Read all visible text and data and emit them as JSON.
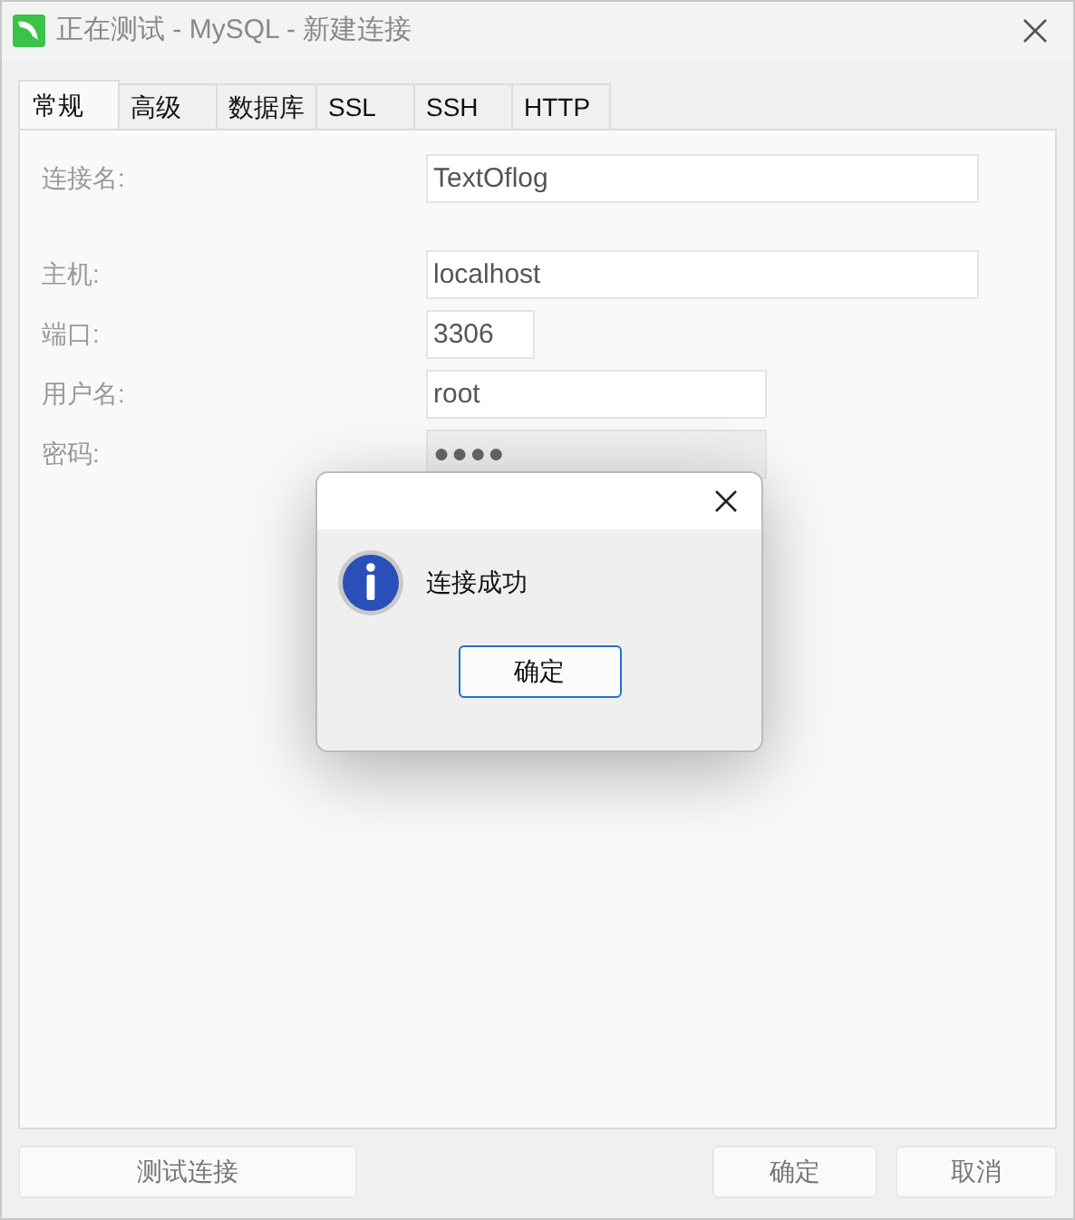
{
  "window": {
    "title": "正在测试 - MySQL - 新建连接"
  },
  "tabs": [
    {
      "label": "常规",
      "selected": true
    },
    {
      "label": "高级",
      "selected": false
    },
    {
      "label": "数据库",
      "selected": false
    },
    {
      "label": "SSL",
      "selected": false
    },
    {
      "label": "SSH",
      "selected": false
    },
    {
      "label": "HTTP",
      "selected": false
    }
  ],
  "form_groups": [
    [
      {
        "label": "连接名:",
        "value": "TextOflog",
        "kind": "text"
      }
    ],
    [
      {
        "label": "主机:",
        "value": "localhost",
        "kind": "text"
      },
      {
        "label": "端口:",
        "value": "3306",
        "kind": "text"
      },
      {
        "label": "用户名:",
        "value": "root",
        "kind": "text"
      },
      {
        "label": "密码:",
        "value": "●●●●",
        "kind": "password"
      }
    ]
  ],
  "buttons": {
    "test": "测试连接",
    "ok": "确定",
    "cancel": "取消"
  },
  "dialog": {
    "message": "连接成功",
    "button": "确定"
  }
}
